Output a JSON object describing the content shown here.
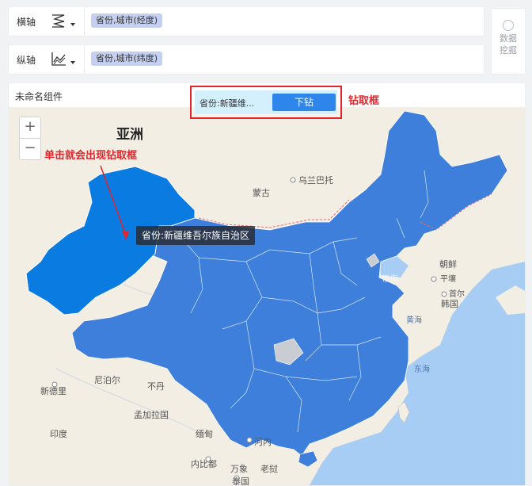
{
  "x_axis": {
    "label": "横轴",
    "field": "省份,城市(经度)",
    "icon": "zigzag-axis-icon"
  },
  "y_axis": {
    "label": "纵轴",
    "field": "省份,城市(纬度)",
    "icon": "line-chart-axis-icon"
  },
  "data_mining": {
    "label_line1": "数据",
    "label_line2": "挖掘",
    "icon": "data-mining-icon"
  },
  "chart": {
    "title": "未命名组件",
    "zoom_in": "+",
    "zoom_out": "−",
    "tooltip": "省份:新疆维吾尔族自治区",
    "drill": {
      "selected": "省份:新疆维...",
      "button": "下钻"
    }
  },
  "map": {
    "labels": {
      "asia": "亚洲",
      "mongolia": "蒙古",
      "ulaanbaatar": "乌兰巴托",
      "north_korea": "朝鲜",
      "pyongyang": "平壤",
      "seoul": "首尔",
      "south_korea": "韩国",
      "bohai": "渤海",
      "yellow_sea": "黄海",
      "east_sea": "东海",
      "nepal": "尼泊尔",
      "bhutan": "不丹",
      "new_delhi": "新德里",
      "bangladesh": "孟加拉国",
      "india": "印度",
      "myanmar": "缅甸",
      "hanoi": "河内",
      "naypyidaw": "内比都",
      "vientiane": "万象",
      "laos": "老挝",
      "thailand": "泰国"
    },
    "colors": {
      "highlight_region": "#0a7be0",
      "regions": "#3e7fdb",
      "land": "#f2eee4",
      "sea": "#a8cdf4"
    }
  },
  "annotations": {
    "drill_box_label": "钻取框",
    "click_hint": "单击就会出现钻取框"
  }
}
